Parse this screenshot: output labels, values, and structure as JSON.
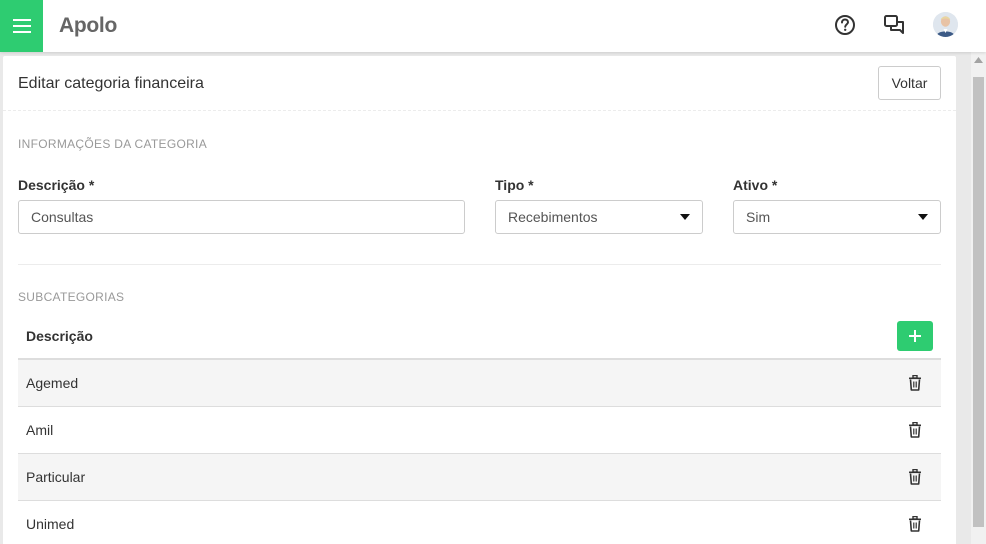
{
  "app": {
    "title": "Apolo"
  },
  "header": {
    "menu_icon": "hamburger-icon",
    "help_icon": "help-circle-icon",
    "chat_icon": "chat-icon",
    "avatar_icon": "user-avatar"
  },
  "page": {
    "title": "Editar categoria financeira",
    "back_label": "Voltar"
  },
  "info_section": {
    "title": "INFORMAÇÕES DA CATEGORIA",
    "descricao_label": "Descrição *",
    "descricao_value": "Consultas",
    "tipo_label": "Tipo *",
    "tipo_value": "Recebimentos",
    "ativo_label": "Ativo *",
    "ativo_value": "Sim"
  },
  "subcategories": {
    "title": "SUBCATEGORIAS",
    "column_header": "Descrição",
    "add_icon": "plus-icon",
    "delete_icon": "trash-icon",
    "rows": [
      "Agemed",
      "Amil",
      "Particular",
      "Unimed"
    ]
  },
  "colors": {
    "accent": "#2ecc71"
  }
}
